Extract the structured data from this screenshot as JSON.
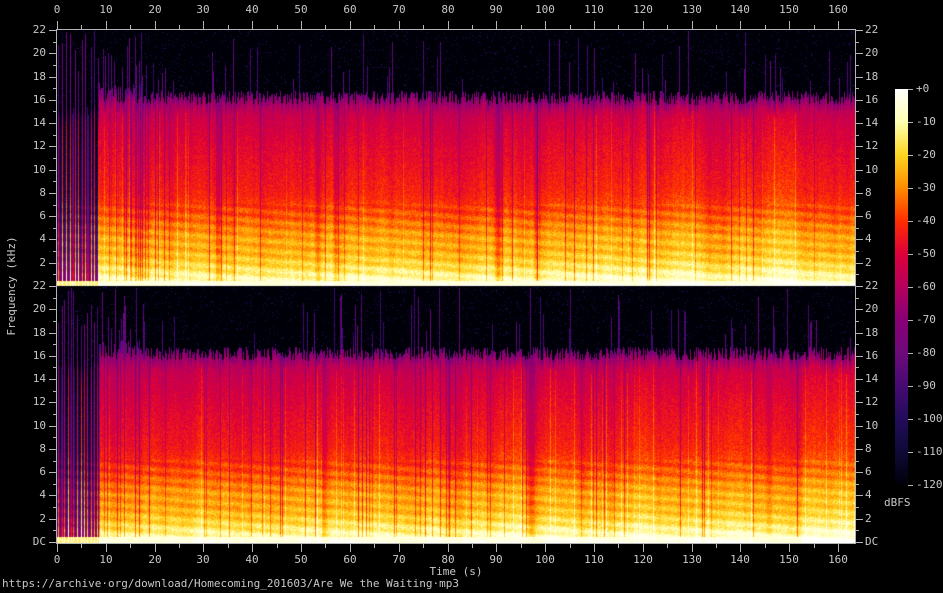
{
  "chart_data": {
    "type": "heatmap",
    "subtype": "stereo-audio-spectrogram",
    "title": "",
    "xlabel": "Time (s)",
    "ylabel": "Frequency (kHz)",
    "channels": 2,
    "x_tick_labels": [
      "0",
      "10",
      "20",
      "30",
      "40",
      "50",
      "60",
      "70",
      "80",
      "90",
      "100",
      "110",
      "120",
      "130",
      "140",
      "150",
      "160"
    ],
    "x_tick_values": [
      0,
      10,
      20,
      30,
      40,
      50,
      60,
      70,
      80,
      90,
      100,
      110,
      120,
      130,
      140,
      150,
      160
    ],
    "x_minor_step_s": 5,
    "x_range_s": [
      0,
      163.5
    ],
    "freq_tick_labels": [
      "22",
      "20",
      "18",
      "16",
      "14",
      "12",
      "10",
      "8",
      "6",
      "4",
      "2"
    ],
    "freq_tick_values_khz": [
      22,
      20,
      18,
      16,
      14,
      12,
      10,
      8,
      6,
      4,
      2
    ],
    "freq_minor_step_khz": 1,
    "dc_label": "DC",
    "freq_range_khz": [
      0,
      22
    ],
    "colorbar": {
      "label": "dBFS",
      "tick_labels": [
        "+0",
        "-10",
        "-20",
        "-30",
        "-40",
        "-50",
        "-60",
        "-70",
        "-80",
        "-90",
        "-100",
        "-110",
        "-120"
      ],
      "tick_values_db": [
        0,
        -10,
        -20,
        -30,
        -40,
        -50,
        -60,
        -70,
        -80,
        -90,
        -100,
        -110,
        -120
      ],
      "range_db": [
        0,
        -120
      ],
      "gradient_stops": [
        "#ffffff",
        "#ffffb2",
        "#ffd520",
        "#ff8c00",
        "#ff2d00",
        "#dd003a",
        "#b5005e",
        "#870076",
        "#6e0a7b",
        "#460a73",
        "#230c5a",
        "#0e0a37",
        "#000008"
      ]
    },
    "band_profile_khz_db": [
      [
        0,
        -2
      ],
      [
        0.3,
        -7
      ],
      [
        1,
        -13
      ],
      [
        2,
        -20
      ],
      [
        3,
        -25
      ],
      [
        4,
        -26
      ],
      [
        5,
        -31
      ],
      [
        6,
        -36
      ],
      [
        8,
        -43
      ],
      [
        10,
        -46
      ],
      [
        12,
        -49
      ],
      [
        14,
        -53
      ],
      [
        15,
        -56
      ],
      [
        15.9,
        -61
      ],
      [
        16.3,
        -66
      ]
    ],
    "lowpass_cutoff_khz": 16.2,
    "intro_end_s": 8.4,
    "buildup_end_s": 17.5
  },
  "footer": {
    "url": "https://archive·org/download/Homecoming_201603/Are We the Waiting·mp3"
  },
  "colors": {
    "background": "#000000",
    "axis": "#b4b4b4",
    "text": "#c8c8c8"
  }
}
